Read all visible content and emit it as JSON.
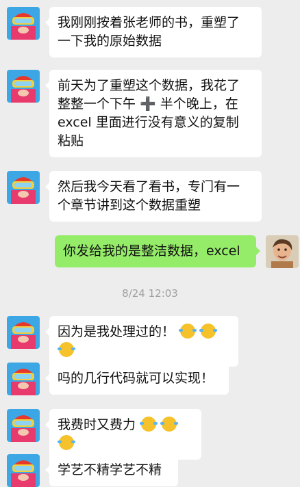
{
  "messages": [
    {
      "side": "left",
      "lines": [
        "我刚刚按着张老师的书，重塑了",
        "一下我的原始数据"
      ]
    },
    {
      "side": "left",
      "lines": [
        "前天为了重塑这个数据，我花了",
        "整整一个下午 ➕ 半个晚上，在",
        "excel 里面进行没有意义的复制",
        "粘贴"
      ]
    },
    {
      "side": "left",
      "lines": [
        "然后我今天看了看书，专门有一",
        "个章节讲到这个数据重塑"
      ]
    },
    {
      "side": "right",
      "lines": [
        "你发给我的是整洁数据，excel"
      ]
    },
    {
      "side": "left",
      "text": "因为是我处理过的！",
      "emoji_count": 3
    },
    {
      "side": "left",
      "text": "吗的几行代码就可以实现！"
    },
    {
      "side": "left",
      "text": "我费时又费力",
      "emoji_count": 3
    },
    {
      "side": "left",
      "text": "学艺不精学艺不精"
    }
  ],
  "timestamp": "8/24 12:03",
  "emoji": {
    "icon": "laugh-cry-emoji",
    "glyph": "😂"
  },
  "colors": {
    "background": "#ededed",
    "bubble_left": "#ffffff",
    "bubble_right": "#95ec69"
  }
}
